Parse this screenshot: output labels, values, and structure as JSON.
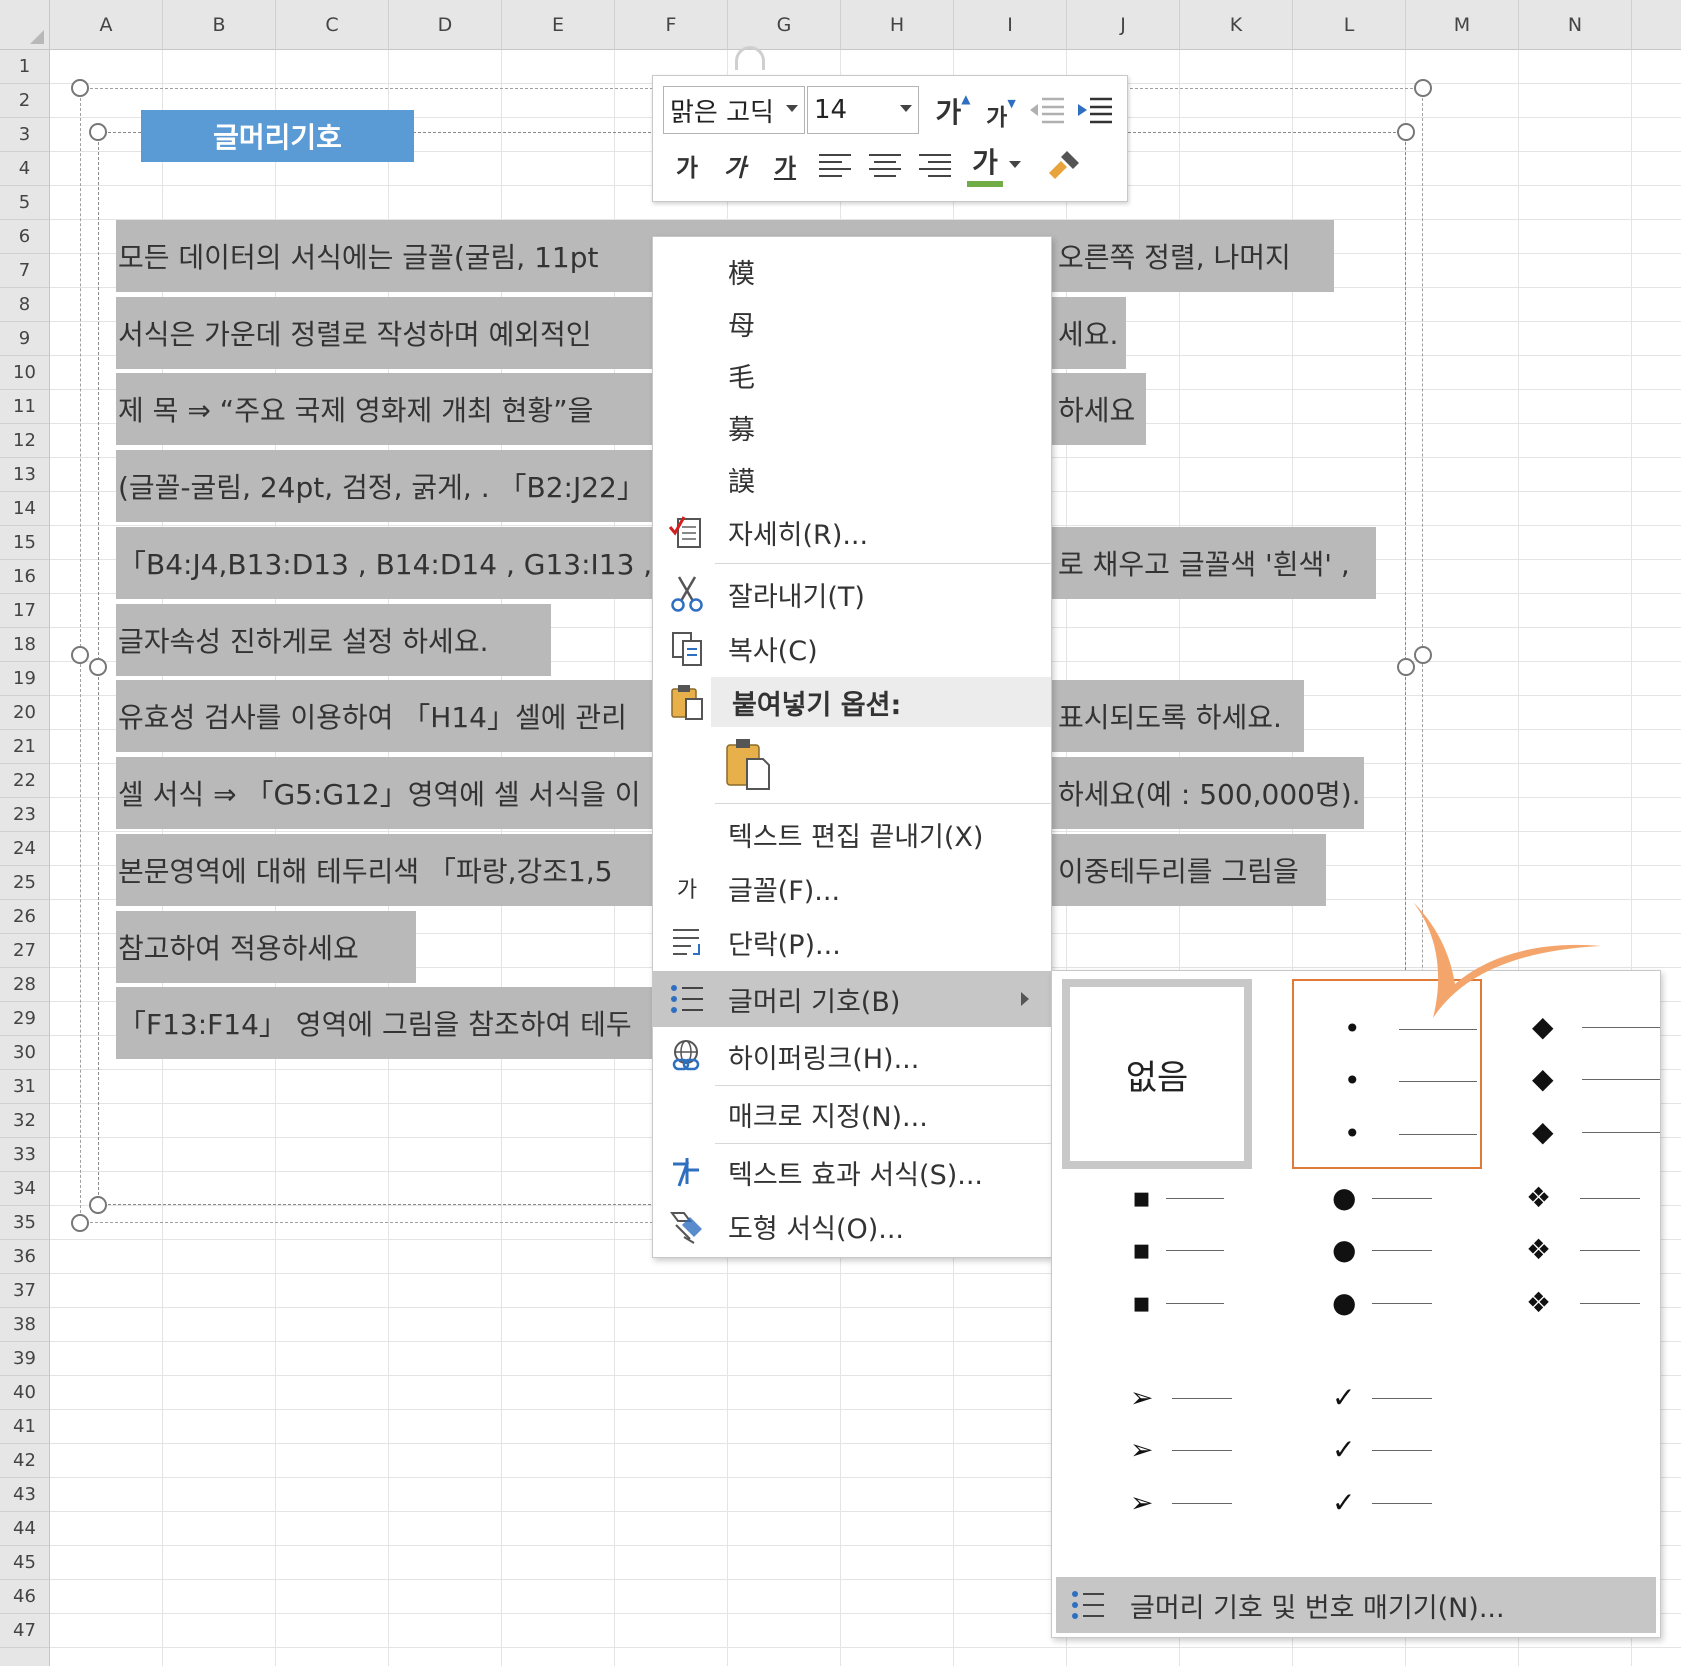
{
  "sheet": {
    "columns": [
      "A",
      "B",
      "C",
      "D",
      "E",
      "F",
      "G",
      "H",
      "I",
      "J",
      "K",
      "L",
      "M",
      "N"
    ],
    "rows": [
      "1",
      "2",
      "3",
      "4",
      "5",
      "6",
      "7",
      "8",
      "9",
      "10",
      "11",
      "12",
      "13",
      "14",
      "15",
      "16",
      "17",
      "18",
      "19",
      "20",
      "21",
      "22",
      "23",
      "24",
      "25",
      "26",
      "27",
      "28",
      "29",
      "30",
      "31",
      "32",
      "33",
      "34",
      "35",
      "36",
      "37",
      "38",
      "39",
      "40",
      "41",
      "42",
      "43",
      "44",
      "45",
      "46",
      "47"
    ]
  },
  "textbox": {
    "title": "글머리기호",
    "lines": [
      {
        "left": "모든 데이터의 서식에는 글꼴(굴림, 11pt",
        "right": "오른쪽 정렬, 나머지"
      },
      {
        "left": "서식은 가운데 정렬로 작성하며 예외적인",
        "right": "세요."
      },
      {
        "left": "제 목 ⇒ “주요 국제 영화제 개최 현황”을",
        "right": "하세요"
      },
      {
        "left": "(글꼴-굴림, 24pt, 검정, 굵게, . 「B2:J22」",
        "right": ""
      },
      {
        "left": "「B4:J4,B13:D13 , B14:D14 , G13:I13 , G1",
        "right": "로 채우고 글꼴색 '흰색' ,"
      },
      {
        "left": "글자속성 진하게로 설정 하세요.",
        "right": ""
      },
      {
        "left": "유효성 검사를 이용하여 「H14」셀에 관리",
        "right": "표시되도록 하세요."
      },
      {
        "left": "셀 서식 ⇒ 「G5:G12」영역에 셀 서식을 이",
        "right": "하세요(예 : 500,000명)."
      },
      {
        "left": "본문영역에 대해 테두리색 「파랑,강조1,5",
        "right": "이중테두리를 그림을"
      },
      {
        "left": "참고하여 적용하세요",
        "right": ""
      },
      {
        "left": "「F13:F14」 영역에 그림을 참조하여 테두",
        "right": ""
      }
    ]
  },
  "mini_toolbar": {
    "font_name": "맑은 고딕",
    "font_size": "14",
    "grow_font": "가",
    "shrink_font": "가",
    "bold": "가",
    "italic": "가",
    "underline": "가",
    "font_color": "가",
    "accent_green": "#70ad47"
  },
  "context_menu": {
    "hanja_chars": [
      "模",
      "母",
      "毛",
      "募",
      "謨"
    ],
    "items": {
      "details": "자세히(R)...",
      "cut": "잘라내기(T)",
      "copy": "복사(C)",
      "paste_options": "붙여넣기 옵션:",
      "exit_text_edit": "텍스트 편집 끝내기(X)",
      "font": "글꼴(F)...",
      "font_icon": "가",
      "paragraph": "단락(P)...",
      "bullets": "글머리 기호(B)",
      "hyperlink": "하이퍼링크(H)...",
      "assign_macro": "매크로 지정(N)...",
      "text_effects": "텍스트 효과 서식(S)...",
      "format_shape": "도형 서식(O)..."
    }
  },
  "bullet_gallery": {
    "none_label": "없음",
    "footer": "글머리 기호 및 번호 매기기(N)...",
    "styles": [
      {
        "name": "small-bullet",
        "symbol": "•"
      },
      {
        "name": "diamond",
        "symbol": "◆"
      },
      {
        "name": "square",
        "symbol": "▪"
      },
      {
        "name": "large-bullet",
        "symbol": "●"
      },
      {
        "name": "four-diamond",
        "symbol": "❖"
      },
      {
        "name": "arrow",
        "symbol": "➢"
      },
      {
        "name": "check",
        "symbol": "✓"
      }
    ],
    "selected_style": "small-bullet",
    "selected_color": "#e07a36",
    "annotation_color": "#f4a56c"
  }
}
